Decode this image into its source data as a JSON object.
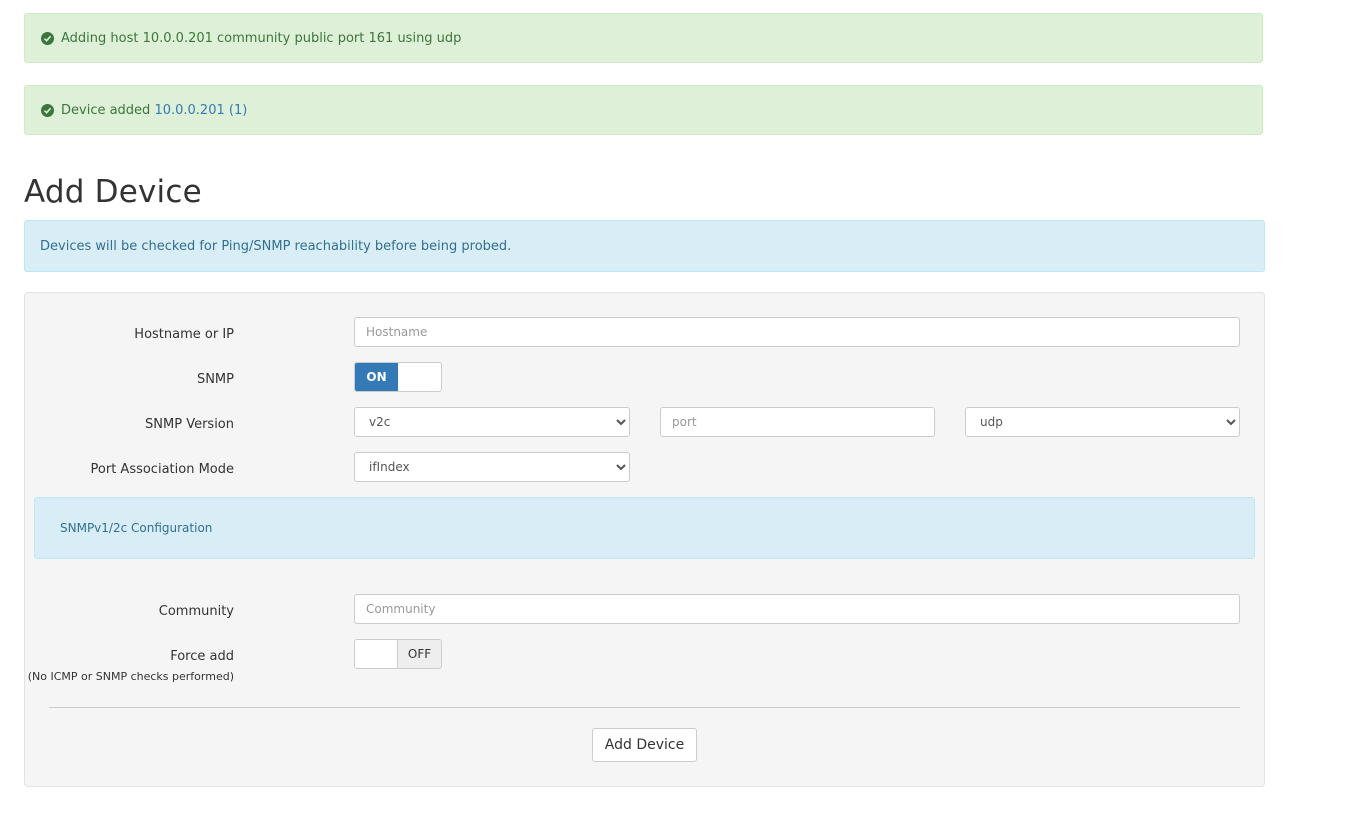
{
  "alerts": {
    "adding": {
      "text": "Adding host 10.0.0.201 community public port 161 using udp"
    },
    "added": {
      "prefix": "Device added ",
      "link_text": "10.0.0.201 (1)"
    }
  },
  "page_title": "Add Device",
  "info_text": "Devices will be checked for Ping/SNMP reachability before being probed.",
  "form": {
    "hostname": {
      "label": "Hostname or IP",
      "placeholder": "Hostname",
      "value": ""
    },
    "snmp": {
      "label": "SNMP",
      "toggle_text": "ON",
      "state": "on"
    },
    "snmp_version": {
      "label": "SNMP Version",
      "selected": "v2c",
      "port_placeholder": "port",
      "transport_selected": "udp"
    },
    "port_association": {
      "label": "Port Association Mode",
      "selected": "ifIndex"
    },
    "snmp_config_title": "SNMPv1/2c Configuration",
    "community": {
      "label": "Community",
      "placeholder": "Community",
      "value": ""
    },
    "force_add": {
      "label": "Force add",
      "sublabel": "(No ICMP or SNMP checks performed)",
      "toggle_text": "OFF",
      "state": "off"
    },
    "submit_label": "Add Device"
  },
  "colors": {
    "success_bg": "#dff0d8",
    "success_text": "#3c763d",
    "info_bg": "#d9edf7",
    "info_text": "#31708f",
    "primary": "#337ab7"
  },
  "icons": {
    "alert_icon": "check-circle-icon",
    "select_arrow": "chevron-down-icon"
  }
}
